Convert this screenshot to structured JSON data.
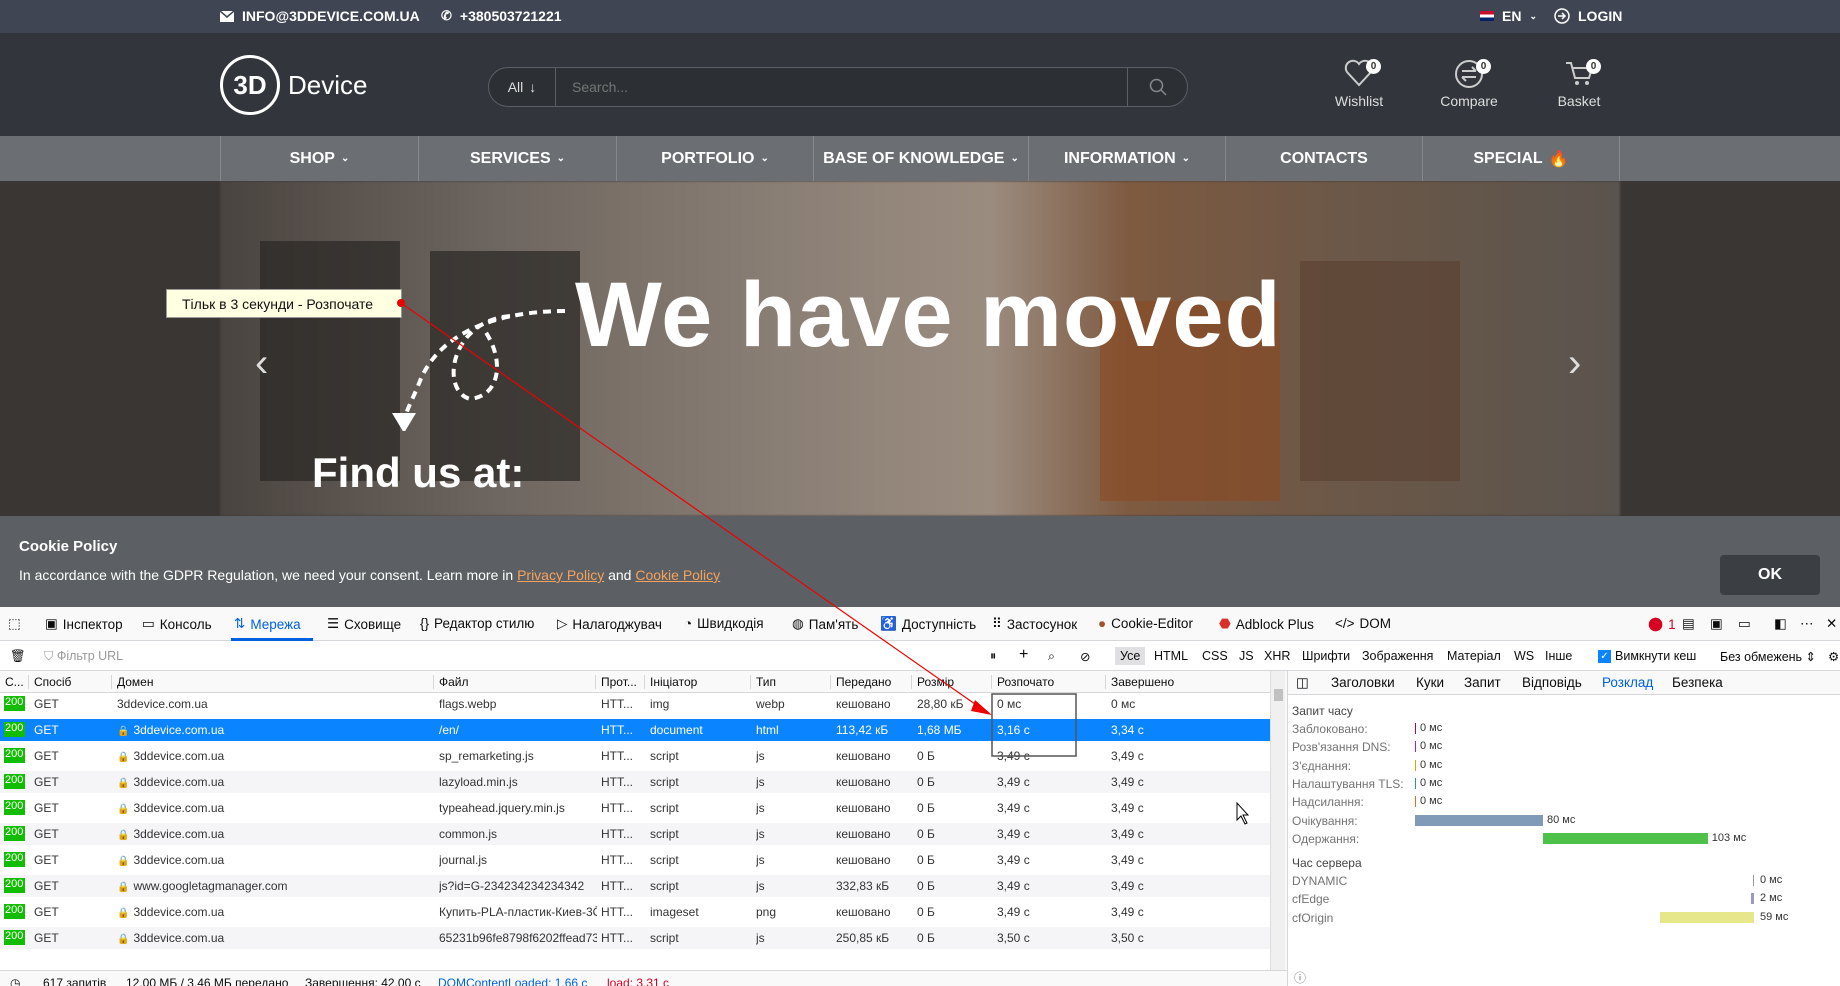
{
  "topbar": {
    "email": "INFO@3DDEVICE.COM.UA",
    "phone": "+380503721221",
    "lang": "EN",
    "login": "LOGIN"
  },
  "header": {
    "logo_mark": "3D",
    "logo_word": "Device",
    "search_scope": "All",
    "search_placeholder": "Search...",
    "icons": [
      {
        "label": "Wishlist",
        "count": "0",
        "icon": "heart-icon"
      },
      {
        "label": "Compare",
        "count": "0",
        "icon": "compare-icon"
      },
      {
        "label": "Basket",
        "count": "0",
        "icon": "basket-icon"
      }
    ]
  },
  "nav": [
    "SHOP",
    "SERVICES",
    "PORTFOLIO",
    "BASE OF KNOWLEDGE",
    "INFORMATION",
    "CONTACTS",
    "SPECIAL"
  ],
  "hero": {
    "headline": "We have moved",
    "subline": "Find us at:"
  },
  "cookie": {
    "title": "Cookie Policy",
    "text_before": "In accordance with the GDPR Regulation, we need your consent. Learn more in ",
    "privacy_link": "Privacy Policy",
    "and": " and ",
    "cookie_link": "Cookie Policy",
    "ok": "OK"
  },
  "tooltip": "Тільк в 3 секунди - Розпочате",
  "devtools": {
    "tabs": [
      "Інспектор",
      "Консоль",
      "Мережа",
      "Сховище",
      "Редактор стилю",
      "Налагоджувач",
      "Швидкодія",
      "Пам'ять",
      "Доступність",
      "Застосунок",
      "Cookie-Editor",
      "Adblock Plus",
      "DOM"
    ],
    "error_count": "1",
    "filter_placeholder": "Фільтр URL",
    "types": [
      "Усе",
      "HTML",
      "CSS",
      "JS",
      "XHR",
      "Шрифти",
      "Зображення",
      "Матеріал",
      "WS",
      "Інше"
    ],
    "disable_cache": "Вимкнути кеш",
    "throttle": "Без обмежень",
    "columns": [
      "С...",
      "Спосіб",
      "Домен",
      "Файл",
      "Прот...",
      "Ініціатор",
      "Тип",
      "Передано",
      "Розмір",
      "Розпочато",
      "Завершено"
    ],
    "rows": [
      {
        "status": "200",
        "method": "GET",
        "domain": "3ddevice.com.ua",
        "file": "flags.webp",
        "proto": "HTT...",
        "initiator": "img",
        "type": "webp",
        "transferred": "кешовано",
        "size": "28,80 кБ",
        "start": "0 мс",
        "end": "0 мс"
      },
      {
        "status": "200",
        "method": "GET",
        "domain": "3ddevice.com.ua",
        "file": "/en/",
        "proto": "HTT...",
        "initiator": "document",
        "type": "html",
        "transferred": "113,42 кБ",
        "size": "1,68 МБ",
        "start": "3,16 с",
        "end": "3,34 с"
      },
      {
        "status": "200",
        "method": "GET",
        "domain": "3ddevice.com.ua",
        "file": "sp_remarketing.js",
        "proto": "HTT...",
        "initiator": "script",
        "type": "js",
        "transferred": "кешовано",
        "size": "0 Б",
        "start": "3,49 с",
        "end": "3,49 с"
      },
      {
        "status": "200",
        "method": "GET",
        "domain": "3ddevice.com.ua",
        "file": "lazyload.min.js",
        "proto": "HTT...",
        "initiator": "script",
        "type": "js",
        "transferred": "кешовано",
        "size": "0 Б",
        "start": "3,49 с",
        "end": "3,49 с"
      },
      {
        "status": "200",
        "method": "GET",
        "domain": "3ddevice.com.ua",
        "file": "typeahead.jquery.min.js",
        "proto": "HTT...",
        "initiator": "script",
        "type": "js",
        "transferred": "кешовано",
        "size": "0 Б",
        "start": "3,49 с",
        "end": "3,49 с"
      },
      {
        "status": "200",
        "method": "GET",
        "domain": "3ddevice.com.ua",
        "file": "common.js",
        "proto": "HTT...",
        "initiator": "script",
        "type": "js",
        "transferred": "кешовано",
        "size": "0 Б",
        "start": "3,49 с",
        "end": "3,49 с"
      },
      {
        "status": "200",
        "method": "GET",
        "domain": "3ddevice.com.ua",
        "file": "journal.js",
        "proto": "HTT...",
        "initiator": "script",
        "type": "js",
        "transferred": "кешовано",
        "size": "0 Б",
        "start": "3,49 с",
        "end": "3,49 с"
      },
      {
        "status": "200",
        "method": "GET",
        "domain": "www.googletagmanager.com",
        "file": "js?id=G-234234234234342",
        "proto": "HTT...",
        "initiator": "script",
        "type": "js",
        "transferred": "332,83 кБ",
        "size": "0 Б",
        "start": "3,49 с",
        "end": "3,49 с"
      },
      {
        "status": "200",
        "method": "GET",
        "domain": "3ddevice.com.ua",
        "file": "Купить-PLA-пластик-Киев-3Ö",
        "proto": "HTT...",
        "initiator": "imageset",
        "type": "png",
        "transferred": "кешовано",
        "size": "0 Б",
        "start": "3,49 с",
        "end": "3,49 с"
      },
      {
        "status": "200",
        "method": "GET",
        "domain": "3ddevice.com.ua",
        "file": "65231b96fe8798f6202ffead73f",
        "proto": "HTT...",
        "initiator": "script",
        "type": "js",
        "transferred": "250,85 кБ",
        "size": "0 Б",
        "start": "3,50 с",
        "end": "3,50 с"
      }
    ],
    "side_tabs": [
      "Заголовки",
      "Куки",
      "Запит",
      "Відповідь",
      "Розклад",
      "Безпека"
    ],
    "timing_title": "Запит часу",
    "timings": [
      {
        "label": "Заблоковано:",
        "value": "0 мс",
        "color": "#c50042"
      },
      {
        "label": "Розв'язання DNS:",
        "value": "0 мс",
        "color": "#a91bd6"
      },
      {
        "label": "З'єднання:",
        "value": "0 мс",
        "color": "#e0a300"
      },
      {
        "label": "Налаштування TLS:",
        "value": "0 мс",
        "color": "#2a9a76"
      },
      {
        "label": "Надсилання:",
        "value": "0 мс",
        "color": "#e16a1e"
      },
      {
        "label": "Очікування:",
        "value": "80 мс",
        "color": "#7f9bb7"
      },
      {
        "label": "Одержання:",
        "value": "103 мс",
        "color": "#4ec14b"
      }
    ],
    "server_title": "Час сервера",
    "server": [
      {
        "label": "DYNAMIC",
        "value": "0 мс",
        "color": "#999999"
      },
      {
        "label": "cfEdge",
        "value": "2 мс",
        "color": "#9a9ac8"
      },
      {
        "label": "cfOrigin",
        "value": "59 мс",
        "color": "#e6e68a"
      }
    ],
    "status": {
      "requests": "617 запитів",
      "transferred": "12,00 МБ / 3,46 МБ передано",
      "finish": "Завершення: 42,00 с",
      "dcl": "DOMContentLoaded: 1,66 с",
      "load": "load: 3,31 с"
    }
  }
}
